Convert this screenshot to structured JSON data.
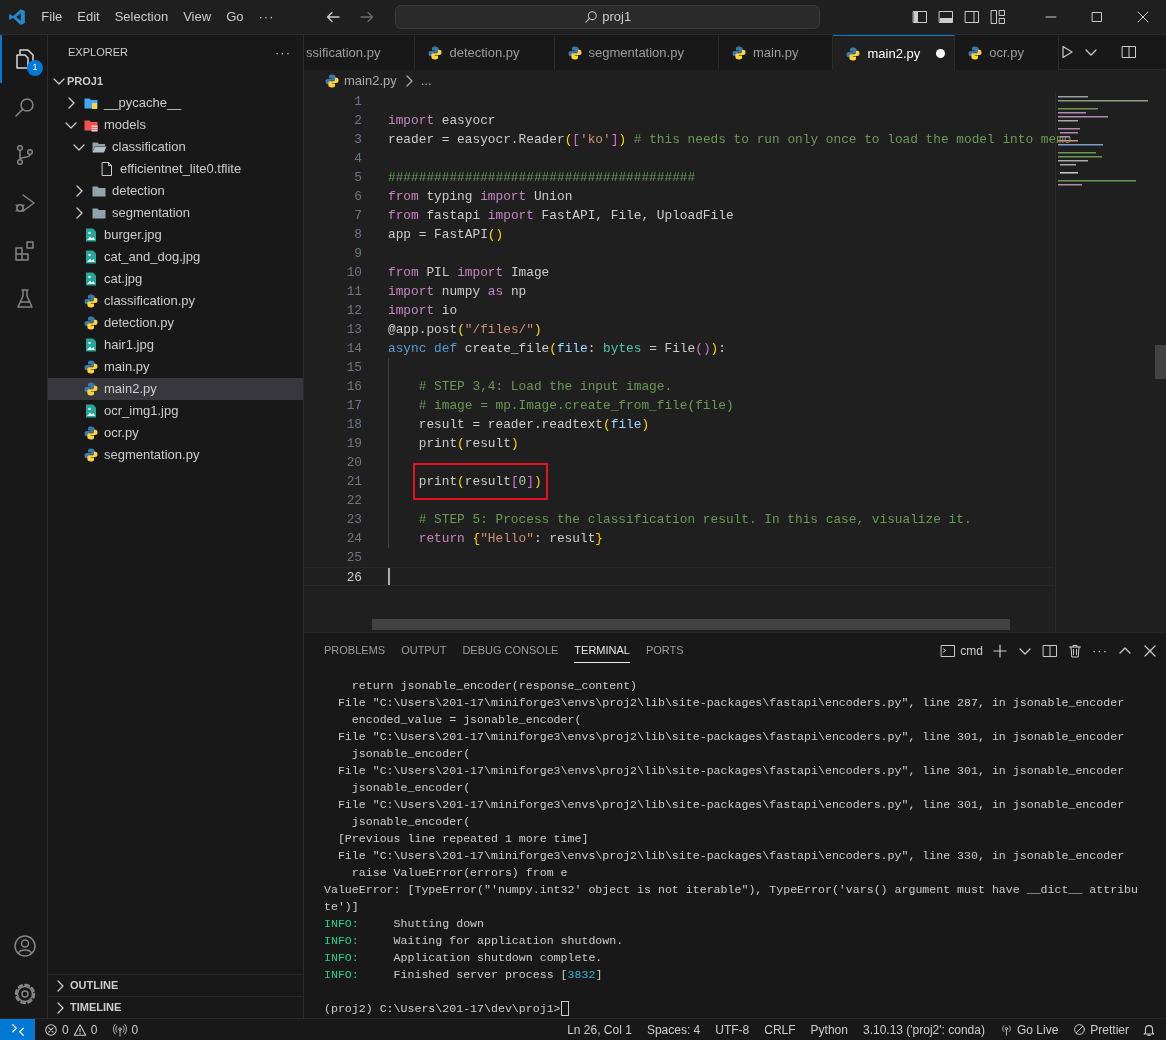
{
  "title_bar": {
    "menus": [
      "File",
      "Edit",
      "Selection",
      "View",
      "Go"
    ],
    "more": "···",
    "search": "proj1"
  },
  "activity_bar": {
    "items": [
      {
        "kind": "explorer",
        "selected": true,
        "badge": "1"
      },
      {
        "kind": "search",
        "selected": false
      },
      {
        "kind": "source-control",
        "selected": false
      },
      {
        "kind": "run-debug",
        "selected": false
      },
      {
        "kind": "extensions",
        "selected": false
      },
      {
        "kind": "testing",
        "selected": false
      }
    ],
    "bottom": [
      {
        "kind": "account"
      },
      {
        "kind": "settings"
      }
    ]
  },
  "sidebar": {
    "title": "EXPLORER",
    "more": "···",
    "root": {
      "label": "PROJ1",
      "expanded": true,
      "children": [
        {
          "label": "__pycache__",
          "kind": "folder-python",
          "expanded": false,
          "selected": false
        },
        {
          "label": "models",
          "kind": "folder-models",
          "expanded": true,
          "selected": false,
          "children": [
            {
              "label": "classification",
              "kind": "folder",
              "expanded": true,
              "selected": false,
              "children": [
                {
                  "label": "efficientnet_lite0.tflite",
                  "kind": "file",
                  "selected": false
                }
              ]
            },
            {
              "label": "detection",
              "kind": "folder",
              "expanded": false,
              "selected": false
            },
            {
              "label": "segmentation",
              "kind": "folder",
              "expanded": false,
              "selected": false
            }
          ]
        },
        {
          "label": "burger.jpg",
          "kind": "image",
          "selected": false
        },
        {
          "label": "cat_and_dog.jpg",
          "kind": "image",
          "selected": false
        },
        {
          "label": "cat.jpg",
          "kind": "image",
          "selected": false
        },
        {
          "label": "classification.py",
          "kind": "python",
          "selected": false
        },
        {
          "label": "detection.py",
          "kind": "python",
          "selected": false
        },
        {
          "label": "hair1.jpg",
          "kind": "image",
          "selected": false
        },
        {
          "label": "main.py",
          "kind": "python",
          "selected": false
        },
        {
          "label": "main2.py",
          "kind": "python",
          "selected": true
        },
        {
          "label": "ocr_img1.jpg",
          "kind": "image",
          "selected": false
        },
        {
          "label": "ocr.py",
          "kind": "python",
          "selected": false
        },
        {
          "label": "segmentation.py",
          "kind": "python",
          "selected": false
        }
      ]
    },
    "sections": [
      {
        "label": "OUTLINE",
        "expanded": false
      },
      {
        "label": "TIMELINE",
        "expanded": false
      }
    ]
  },
  "tabs": [
    {
      "label": "ssification.py",
      "kind": "cut",
      "selected": false,
      "dirty": false
    },
    {
      "label": "detection.py",
      "kind": "python",
      "selected": false,
      "dirty": false
    },
    {
      "label": "segmentation.py",
      "kind": "python",
      "selected": false,
      "dirty": false
    },
    {
      "label": "main.py",
      "kind": "python",
      "selected": false,
      "dirty": false
    },
    {
      "label": "main2.py",
      "kind": "python",
      "selected": true,
      "dirty": true
    },
    {
      "label": "ocr.py",
      "kind": "python",
      "selected": false,
      "dirty": false
    }
  ],
  "breadcrumb": [
    "main2.py",
    "..."
  ],
  "editor": {
    "lines": [
      {
        "number": "1"
      },
      {
        "number": "2",
        "tokens": [
          {
            "text": "import",
            "kind": "keyword"
          },
          {
            "text": " easyocr",
            "kind": "plain"
          }
        ]
      },
      {
        "number": "3",
        "tokens": [
          {
            "text": "reader = easyocr.Reader",
            "kind": "plain"
          },
          {
            "text": "(",
            "kind": "bracket1"
          },
          {
            "text": "[",
            "kind": "bracket2"
          },
          {
            "text": "'ko'",
            "kind": "string"
          },
          {
            "text": "]",
            "kind": "bracket2"
          },
          {
            "text": ")",
            "kind": "bracket1"
          },
          {
            "text": " # this needs to run only once to load the model into memo",
            "kind": "comment"
          }
        ]
      },
      {
        "number": "4"
      },
      {
        "number": "5",
        "tokens": [
          {
            "text": "########################################",
            "kind": "comment"
          }
        ]
      },
      {
        "number": "6",
        "tokens": [
          {
            "text": "from",
            "kind": "keyword"
          },
          {
            "text": " typing ",
            "kind": "plain"
          },
          {
            "text": "import",
            "kind": "keyword"
          },
          {
            "text": " Union",
            "kind": "plain"
          }
        ]
      },
      {
        "number": "7",
        "tokens": [
          {
            "text": "from",
            "kind": "keyword"
          },
          {
            "text": " fastapi ",
            "kind": "plain"
          },
          {
            "text": "import",
            "kind": "keyword"
          },
          {
            "text": " FastAPI, File, UploadFile",
            "kind": "plain"
          }
        ]
      },
      {
        "number": "8",
        "tokens": [
          {
            "text": "app = FastAPI",
            "kind": "plain"
          },
          {
            "text": "()",
            "kind": "bracket1"
          }
        ]
      },
      {
        "number": "9"
      },
      {
        "number": "10",
        "tokens": [
          {
            "text": "from",
            "kind": "keyword"
          },
          {
            "text": " PIL ",
            "kind": "plain"
          },
          {
            "text": "import",
            "kind": "keyword"
          },
          {
            "text": " Image",
            "kind": "plain"
          }
        ]
      },
      {
        "number": "11",
        "tokens": [
          {
            "text": "import",
            "kind": "keyword"
          },
          {
            "text": " numpy ",
            "kind": "plain"
          },
          {
            "text": "as",
            "kind": "keyword"
          },
          {
            "text": " np",
            "kind": "plain"
          }
        ]
      },
      {
        "number": "12",
        "tokens": [
          {
            "text": "import",
            "kind": "keyword"
          },
          {
            "text": " io",
            "kind": "plain"
          }
        ]
      },
      {
        "number": "13",
        "tokens": [
          {
            "text": "@app.post",
            "kind": "plain"
          },
          {
            "text": "(",
            "kind": "bracket1"
          },
          {
            "text": "\"/files/\"",
            "kind": "string"
          },
          {
            "text": ")",
            "kind": "bracket1"
          }
        ]
      },
      {
        "number": "14",
        "tokens": [
          {
            "text": "async def",
            "kind": "storage"
          },
          {
            "text": " create_file",
            "kind": "plain"
          },
          {
            "text": "(",
            "kind": "bracket1"
          },
          {
            "text": "file",
            "kind": "param"
          },
          {
            "text": ": ",
            "kind": "plain"
          },
          {
            "text": "bytes",
            "kind": "type"
          },
          {
            "text": " = File",
            "kind": "plain"
          },
          {
            "text": "()",
            "kind": "bracket2"
          },
          {
            "text": ")",
            "kind": "bracket1"
          },
          {
            "text": ":",
            "kind": "plain"
          }
        ]
      },
      {
        "number": "15",
        "kind": "body"
      },
      {
        "number": "16",
        "kind": "body",
        "tokens": [
          {
            "text": "# STEP 3,4: Load the input image.",
            "kind": "comment"
          }
        ]
      },
      {
        "number": "17",
        "kind": "body",
        "tokens": [
          {
            "text": "# image = mp.Image.create_from_file(file)",
            "kind": "comment"
          }
        ]
      },
      {
        "number": "18",
        "kind": "body",
        "tokens": [
          {
            "text": "result = reader.readtext",
            "kind": "plain"
          },
          {
            "text": "(",
            "kind": "bracket1"
          },
          {
            "text": "file",
            "kind": "param"
          },
          {
            "text": ")",
            "kind": "bracket1"
          }
        ]
      },
      {
        "number": "19",
        "kind": "body",
        "tokens": [
          {
            "text": "print",
            "kind": "plain"
          },
          {
            "text": "(",
            "kind": "bracket1"
          },
          {
            "text": "result",
            "kind": "plain"
          },
          {
            "text": ")",
            "kind": "bracket1"
          }
        ]
      },
      {
        "number": "20",
        "kind": "body"
      },
      {
        "number": "21",
        "kind": "body",
        "tokens": [
          {
            "kind": "box",
            "tokens": [
              {
                "text": "print",
                "kind": "plain"
              },
              {
                "text": "(",
                "kind": "bracket1"
              },
              {
                "text": "result",
                "kind": "plain"
              },
              {
                "text": "[",
                "kind": "bracket2"
              },
              {
                "text": "0",
                "kind": "number"
              },
              {
                "text": "]",
                "kind": "bracket2"
              },
              {
                "text": ")",
                "kind": "bracket1"
              }
            ]
          }
        ]
      },
      {
        "number": "22",
        "kind": "body"
      },
      {
        "number": "23",
        "kind": "body",
        "tokens": [
          {
            "text": "# STEP 5: Process the classification result. In this case, visualize it.",
            "kind": "comment"
          }
        ]
      },
      {
        "number": "24",
        "kind": "body",
        "tokens": [
          {
            "text": "return",
            "kind": "keyword"
          },
          {
            "text": " {",
            "kind": "bracket1"
          },
          {
            "text": "\"Hello\"",
            "kind": "string"
          },
          {
            "text": ": result",
            "kind": "plain"
          },
          {
            "text": "}",
            "kind": "bracket1"
          }
        ]
      },
      {
        "number": "25"
      },
      {
        "number": "26",
        "current": true,
        "cursor": true
      }
    ]
  },
  "panel": {
    "tabs": [
      {
        "label": "PROBLEMS",
        "selected": false
      },
      {
        "label": "OUTPUT",
        "selected": false
      },
      {
        "label": "DEBUG CONSOLE",
        "selected": false
      },
      {
        "label": "TERMINAL",
        "selected": true
      },
      {
        "label": "PORTS",
        "selected": false
      }
    ],
    "terminal_name": "cmd",
    "more": "···",
    "lines": [
      [
        {
          "text": "    return jsonable_encoder(response_content)",
          "kind": "plain"
        }
      ],
      [
        {
          "text": "  File \"C:\\Users\\201-17\\miniforge3\\envs\\proj2\\lib\\site-packages\\fastapi\\encoders.py\", line 287, in jsonable_encoder",
          "kind": "plain"
        }
      ],
      [
        {
          "text": "    encoded_value = jsonable_encoder(",
          "kind": "plain"
        }
      ],
      [
        {
          "text": "  File \"C:\\Users\\201-17\\miniforge3\\envs\\proj2\\lib\\site-packages\\fastapi\\encoders.py\", line 301, in jsonable_encoder",
          "kind": "plain"
        }
      ],
      [
        {
          "text": "    jsonable_encoder(",
          "kind": "plain"
        }
      ],
      [
        {
          "text": "  File \"C:\\Users\\201-17\\miniforge3\\envs\\proj2\\lib\\site-packages\\fastapi\\encoders.py\", line 301, in jsonable_encoder",
          "kind": "plain"
        }
      ],
      [
        {
          "text": "    jsonable_encoder(",
          "kind": "plain"
        }
      ],
      [
        {
          "text": "  File \"C:\\Users\\201-17\\miniforge3\\envs\\proj2\\lib\\site-packages\\fastapi\\encoders.py\", line 301, in jsonable_encoder",
          "kind": "plain"
        }
      ],
      [
        {
          "text": "    jsonable_encoder(",
          "kind": "plain"
        }
      ],
      [
        {
          "text": "  [Previous line repeated 1 more time]",
          "kind": "plain"
        }
      ],
      [
        {
          "text": "  File \"C:\\Users\\201-17\\miniforge3\\envs\\proj2\\lib\\site-packages\\fastapi\\encoders.py\", line 330, in jsonable_encoder",
          "kind": "plain"
        }
      ],
      [
        {
          "text": "    raise ValueError(errors) from e",
          "kind": "plain"
        }
      ],
      [
        {
          "text": "ValueError: [TypeError(\"'numpy.int32' object is not iterable\"), TypeError('vars() argument must have __dict__ attribu",
          "kind": "plain"
        }
      ],
      [
        {
          "text": "te')]",
          "kind": "plain"
        }
      ],
      [
        {
          "text": "INFO:",
          "kind": "info"
        },
        {
          "text": "     Shutting down",
          "kind": "plain"
        }
      ],
      [
        {
          "text": "INFO:",
          "kind": "info"
        },
        {
          "text": "     Waiting for application shutdown.",
          "kind": "plain"
        }
      ],
      [
        {
          "text": "INFO:",
          "kind": "info"
        },
        {
          "text": "     Application shutdown complete.",
          "kind": "plain"
        }
      ],
      [
        {
          "text": "INFO:",
          "kind": "info"
        },
        {
          "text": "     Finished server process [",
          "kind": "plain"
        },
        {
          "text": "3832",
          "kind": "number"
        },
        {
          "text": "]",
          "kind": "plain"
        }
      ]
    ],
    "prompt": "(proj2) C:\\Users\\201-17\\dev\\proj1>"
  },
  "status_bar": {
    "errors": "0",
    "warnings": "0",
    "ports": "0",
    "items": [
      {
        "text": "Ln 26, Col 1",
        "kind": "text"
      },
      {
        "text": "Spaces: 4",
        "kind": "text"
      },
      {
        "text": "UTF-8",
        "kind": "text"
      },
      {
        "text": "CRLF",
        "kind": "text"
      },
      {
        "text": "Python",
        "kind": "text"
      },
      {
        "text": "3.10.13 ('proj2': conda)",
        "kind": "text"
      },
      {
        "text": "Go Live",
        "kind": "broadcast"
      },
      {
        "text": "Prettier",
        "kind": "no-entry"
      }
    ]
  }
}
